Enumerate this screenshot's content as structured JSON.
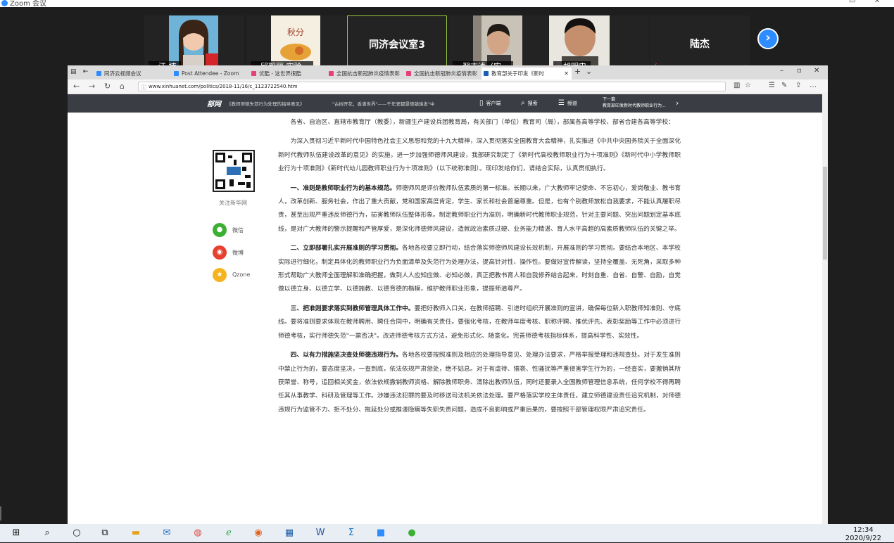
{
  "zoom": {
    "title": "Zoom 会议",
    "participants": [
      {
        "name": "江 楠",
        "muted": true
      },
      {
        "name": "邱毅丽 实验...",
        "muted": true
      },
      {
        "name": "同济会议室3",
        "muted": false
      },
      {
        "name": "翟志清（实...",
        "muted": true
      },
      {
        "name": "胡明忠",
        "muted": true
      },
      {
        "name": "陆杰",
        "muted": true
      }
    ],
    "poster_text": "秋分"
  },
  "browser": {
    "tabs": [
      {
        "label": "同济云视频会议"
      },
      {
        "label": "Post Attendee - Zoom"
      },
      {
        "label": "优酷 - 这世界很酷"
      },
      {
        "label": "全国抗击新冠肺炎疫情表彰"
      },
      {
        "label": "全国抗击新冠肺炎疫情表彰"
      },
      {
        "label": "教育部关于印发《新时"
      }
    ],
    "url": "www.xinhuanet.com/politics/2018-11/16/c_1123722540.htm",
    "site_nav": {
      "logo": "部网",
      "crumb1": "《教师师德失范行为处理的指导意见》",
      "crumb2": "\"古树开花，香满世界\"——千年瓷都景德镇焕发\"中",
      "client": "客户端",
      "search": "搜索",
      "channel": "频道",
      "next_label": "下一篇",
      "next_title": "教育部印发新时代教师职业行为..."
    }
  },
  "sidebar": {
    "follow": "关注新华网",
    "share": [
      {
        "label": "微信",
        "icon": "wechat-icon",
        "color": "#3cb034"
      },
      {
        "label": "微博",
        "icon": "weibo-icon",
        "color": "#e6402f"
      },
      {
        "label": "Qzone",
        "icon": "qzone-icon",
        "color": "#f5b41f"
      }
    ]
  },
  "article": {
    "p0": "各省、自治区、直辖市教育厅（教委），新疆生产建设兵团教育局，有关部门（单位）教育司（局），部属各高等学校、部省合建各高等学校：",
    "p1": "为深入贯彻习近平新时代中国特色社会主义思想和党的十九大精神，深入贯彻落实全国教育大会精神，扎实推进《中共中央国务院关于全面深化新时代教师队伍建设改革的意见》的实施，进一步加强师德师风建设，我部研究制定了《新时代高校教师职业行为十项准则》《新时代中小学教师职业行为十项准则》《新时代幼儿园教师职业行为十项准则》（以下统称准则）。现印发给你们，请结合实际，认真贯彻执行。",
    "p2_bold": "一、准则是教师职业行为的基本规范。",
    "p2": "师德师风是评价教师队伍素质的第一标准。长期以来，广大教师牢记使命、不忘初心，爱岗敬业、教书育人，改革创新、服务社会，作出了重大贡献，党和国家高度肯定，学生、家长和社会普遍尊重。但是，也有个别教师放松自我要求，不能认真履职尽责，甚至出现严重违反师德行为，损害教师队伍整体形象。制定教师职业行为准则，明确新时代教师职业规范，针对主要问题、突出问题划定基本底线，是对广大教师的警示提醒和严管厚爱，是深化师德师风建设，造就政治素质过硬、业务能力精湛、育人水平高超的高素质教师队伍的关键之举。",
    "p3_bold": "二、立即部署扎实开展准则的学习贯彻。",
    "p3": "各地各校要立即行动，结合落实师德师风建设长效机制，开展准则的学习贯彻。要结合本地区、本学校实际进行细化，制定具体化的教师职业行为负面清单及失范行为处理办法，提高针对性、操作性。要做好宣传解读，坚持全覆盖、无死角，采取多种形式帮助广大教师全面理解和准确把握，做到人人应知应做、必知必做，真正把教书育人和自我修养结合起来，时刻自重、自省、自警、自励，自觉做以德立身、以德立学、以德施教、以德育德的楷模，维护教师职业形象，提振师道尊严。",
    "p4_bold": "三、把准则要求落实到教师管理具体工作中。",
    "p4": "要把好教师入口关，在教师招聘、引进时组织开展准则的宣讲，确保每位新入职教师知准则、守底线。要将准则要求体现在教师聘用、聘任合同中，明确有关责任。要强化考核，在教师年度考核、职称评聘、推优评先、表彰奖励等工作中必须进行师德考核，实行师德失范\"一票否决\"。改进师德考核方式方法，避免形式化、随意化。完善师德考核指标体系，提高科学性、实效性。",
    "p5_bold": "四、以有力措施坚决查处师德违规行为。",
    "p5": "各地各校要按照准则及相应的处理指导意见、处理办法要求，严格举报受理和违规查处。对于发生准则中禁止行为的，要态度坚决，一查到底，依法依规严肃惩处，绝不姑息。对于有虐待、猥亵、性骚扰等严重侵害学生行为的，一经查实，要撤销其所获荣誉、称号，追回相关奖金，依法依规撤销教师资格、解除教师职务、清除出教师队伍，同时还要录入全国教师管理信息系统，任何学校不得再聘任其从事教学、科研及管理等工作。涉嫌违法犯罪的要及时移送司法机关依法处理。要严格落实学校主体责任，建立师德建设责任追究机制，对师德违规行为监管不力、拒不处分、拖延处分或推诿隐瞒等失职失责问题，造成不良影响或严重后果的，要按照干部管理权限严肃追究责任。"
  },
  "taskbar": {
    "time": "12:34",
    "date": "2020/9/22"
  }
}
